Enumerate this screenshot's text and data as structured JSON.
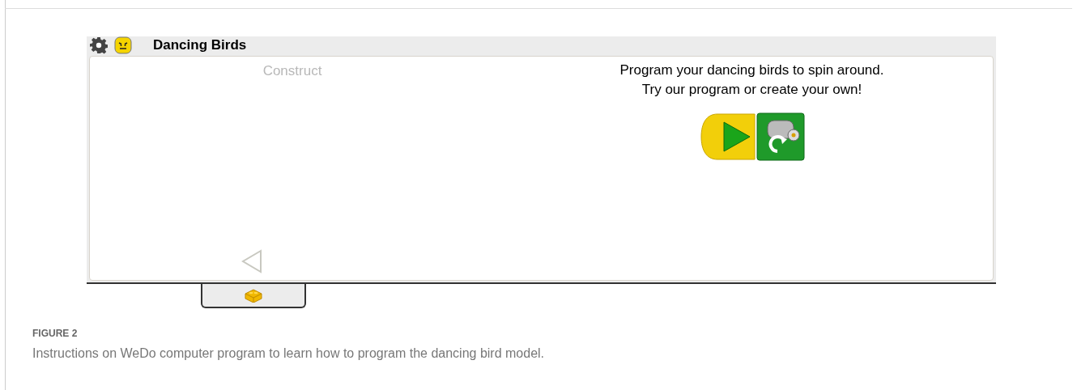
{
  "window": {
    "title": "Dancing Birds"
  },
  "left_panel": {
    "heading": "Construct"
  },
  "instructions": {
    "lines": [
      "Program your dancing birds to spin around.",
      "Try our program or create your own!"
    ]
  },
  "figure": {
    "label": "FIGURE 2",
    "caption": "Instructions on WeDo computer program to learn how to program the dancing bird model."
  }
}
